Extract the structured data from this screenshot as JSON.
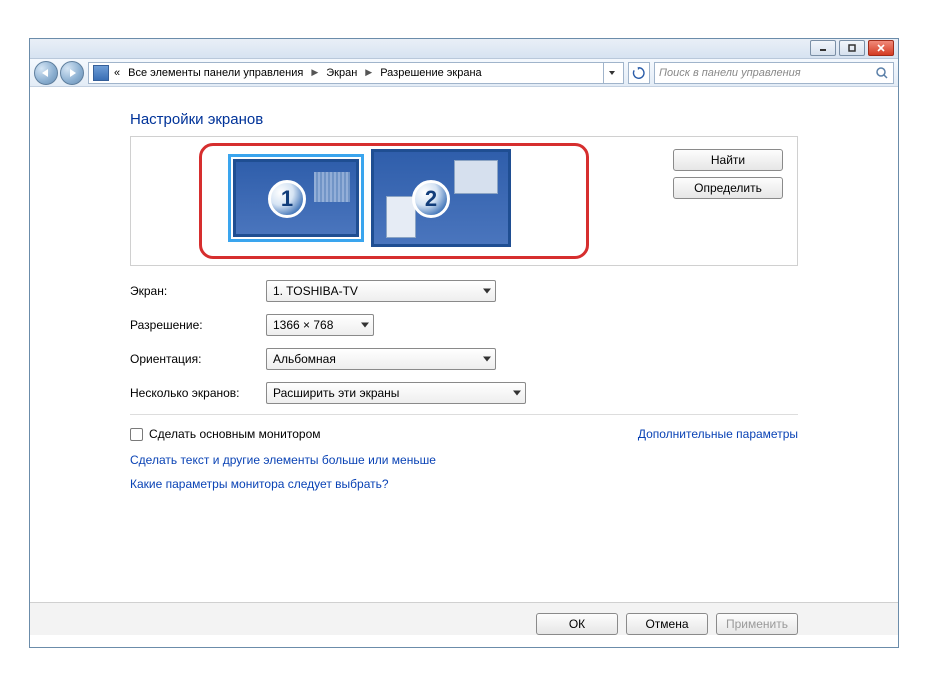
{
  "breadcrumb": {
    "chevron_left": "«",
    "item1": "Все элементы панели управления",
    "item2": "Экран",
    "item3": "Разрешение экрана"
  },
  "search": {
    "placeholder": "Поиск в панели управления"
  },
  "page_title": "Настройки экранов",
  "monitors": {
    "badge1": "1",
    "badge2": "2"
  },
  "side_buttons": {
    "find": "Найти",
    "identify": "Определить"
  },
  "form": {
    "screen_label": "Экран:",
    "screen_value": "1. TOSHIBA-TV",
    "resolution_label": "Разрешение:",
    "resolution_value": "1366 × 768",
    "orientation_label": "Ориентация:",
    "orientation_value": "Альбомная",
    "multi_label": "Несколько экранов:",
    "multi_value": "Расширить эти экраны"
  },
  "checkbox_label": "Сделать основным монитором",
  "advanced_link": "Дополнительные параметры",
  "link1": "Сделать текст и другие элементы больше или меньше",
  "link2": "Какие параметры монитора следует выбрать?",
  "buttons": {
    "ok": "ОК",
    "cancel": "Отмена",
    "apply": "Применить"
  }
}
